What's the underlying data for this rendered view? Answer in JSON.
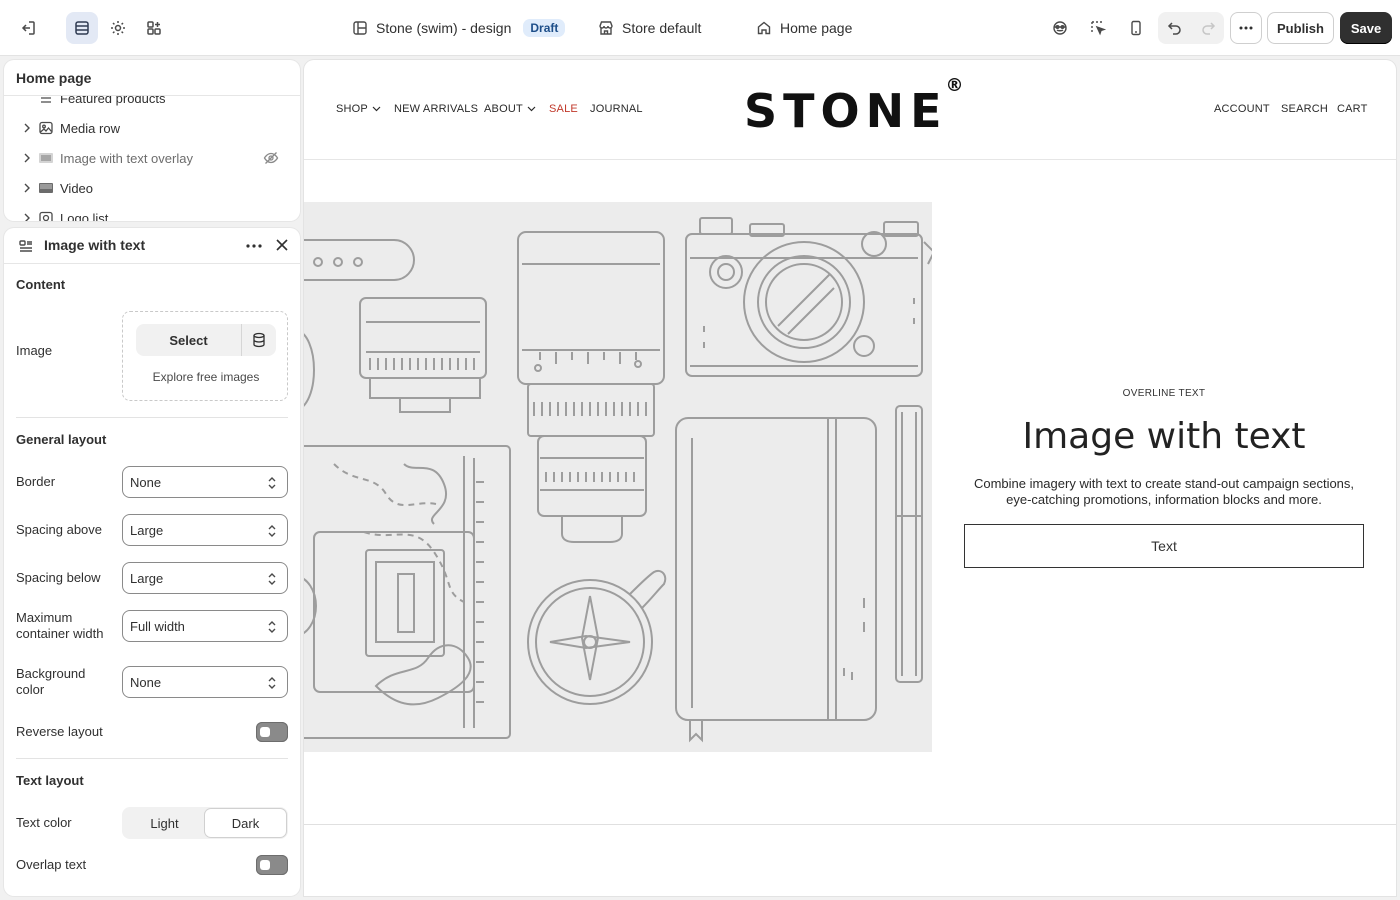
{
  "topbar": {
    "theme_name": "Stone (swim) - design",
    "theme_status": "Draft",
    "store_label": "Store default",
    "page_label": "Home page",
    "publish_label": "Publish",
    "save_label": "Save"
  },
  "section_tree": {
    "title": "Home page",
    "items": [
      {
        "label": "Featured products"
      },
      {
        "label": "Media row"
      },
      {
        "label": "Image with text overlay",
        "hidden": true
      },
      {
        "label": "Video"
      },
      {
        "label": "Logo list"
      }
    ]
  },
  "settings": {
    "title": "Image with text",
    "content_heading": "Content",
    "image_label": "Image",
    "select_label": "Select",
    "explore_label": "Explore free images",
    "general_heading": "General layout",
    "border_label": "Border",
    "border_value": "None",
    "spacing_above_label": "Spacing above",
    "spacing_above_value": "Large",
    "spacing_below_label": "Spacing below",
    "spacing_below_value": "Large",
    "max_width_label": "Maximum container width",
    "max_width_value": "Full width",
    "bg_color_label": "Background color",
    "bg_color_value": "None",
    "reverse_label": "Reverse layout",
    "reverse_on": false,
    "text_heading": "Text layout",
    "text_color_label": "Text color",
    "text_color_options": [
      "Light",
      "Dark"
    ],
    "text_color_selected": "Dark",
    "overlay_label": "Overlap text",
    "overlay_on": false
  },
  "preview": {
    "nav_left": [
      "SHOP",
      "NEW ARRIVALS",
      "ABOUT",
      "SALE",
      "JOURNAL"
    ],
    "nav_right": [
      "ACCOUNT",
      "SEARCH",
      "CART"
    ],
    "logo": "STONE",
    "logo_mark": "®",
    "overline": "OVERLINE TEXT",
    "heading": "Image with text",
    "body": "Combine imagery with text to create stand-out campaign sections, eye-catching promotions, information blocks and more.",
    "button": "Text",
    "sale_color": "#c0392b"
  }
}
